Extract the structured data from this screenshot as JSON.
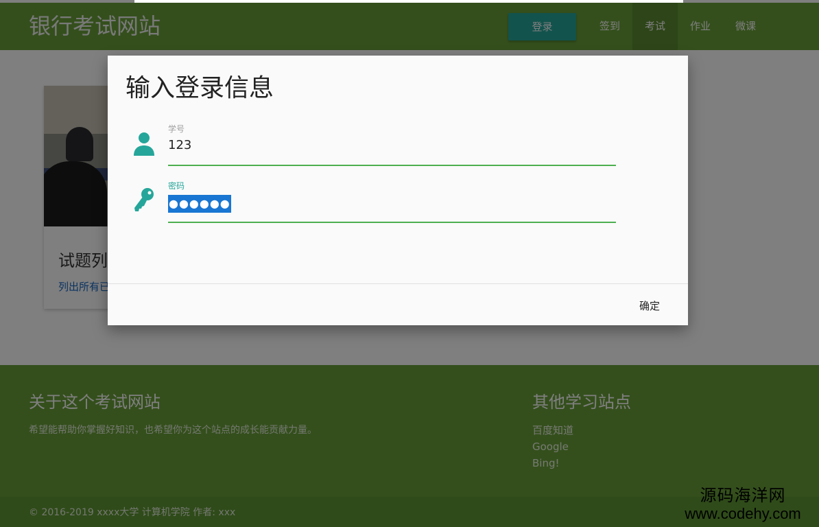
{
  "site": {
    "brand": "银行考试网站"
  },
  "nav": {
    "login_label": "登录",
    "links": [
      {
        "label": "签到"
      },
      {
        "label": "考试",
        "active": true
      },
      {
        "label": "作业"
      },
      {
        "label": "微课"
      }
    ]
  },
  "card": {
    "title": "试题列",
    "link": "列出所有已"
  },
  "footer": {
    "about_title": "关于这个考试网站",
    "about_text": "希望能帮助你掌握好知识，也希望你为这个站点的成长能贡献力量。",
    "links_title": "其他学习站点",
    "links": [
      "百度知道",
      "Google",
      "Bing!"
    ],
    "copyright": "© 2016-2019 xxxx大学 计算机学院  作者: xxx"
  },
  "modal": {
    "title": "输入登录信息",
    "fields": {
      "student_id": {
        "label": "学号",
        "value": "123",
        "icon": "person-icon"
      },
      "password": {
        "label": "密码",
        "masked_value": "●●●●●●",
        "icon": "key-icon"
      }
    },
    "confirm_label": "确定"
  },
  "watermark": {
    "name": "源码海洋网",
    "url": "www.codehy.com"
  },
  "colors": {
    "primary_green": "#689f38",
    "accent_teal": "#26a69a",
    "input_line_green": "#4caf50",
    "selection_blue": "#1976d2"
  }
}
